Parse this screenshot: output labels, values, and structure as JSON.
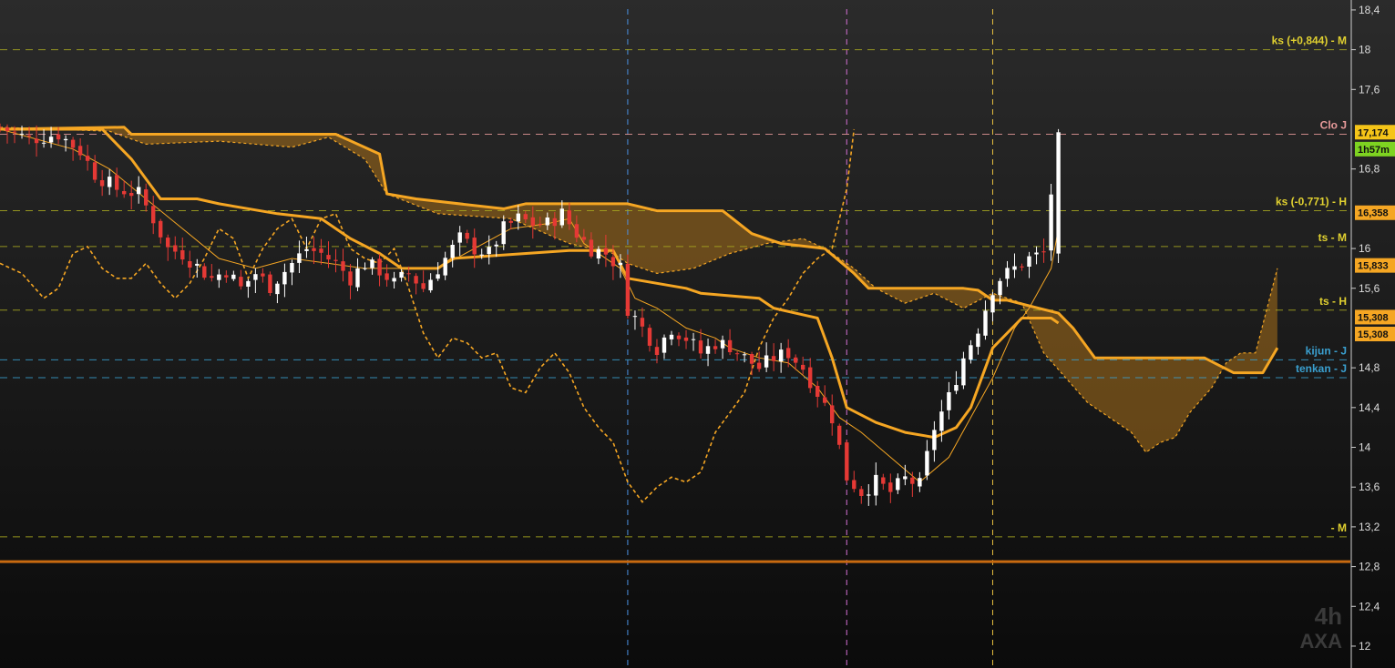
{
  "watermark": {
    "timeframe": "4h",
    "symbol": "AXA"
  },
  "colors": {
    "background_top": "#2a2a2a",
    "background_bottom": "#0c0c0c",
    "ichimoku": "#f5a623",
    "cloud_fill": "#a8701a",
    "bull": "#ffffff",
    "bear": "#e53935",
    "level_yellow": "#a8a820",
    "level_pink": "#e79a9a",
    "level_cyan": "#3aa0d0",
    "support_line": "#c86a10"
  },
  "chart_data": {
    "type": "candlestick",
    "y_axis": {
      "position": "right",
      "range": [
        11.78,
        18.5
      ],
      "ticks": [
        "18,4",
        "18",
        "17,6",
        "16,8",
        "16",
        "15,6",
        "14,8",
        "14,4",
        "14",
        "13,6",
        "13,2",
        "12,8",
        "12,4",
        "12"
      ],
      "tick_values": [
        18.4,
        18.0,
        17.6,
        16.8,
        16.0,
        15.6,
        14.8,
        14.4,
        14.0,
        13.6,
        13.2,
        12.8,
        12.4,
        12.0
      ]
    },
    "x_range": [
      0,
      185
    ],
    "last_candle_index": 145,
    "horizontal_levels": [
      {
        "label": "ks (+0,844) - M",
        "value": 18.0,
        "color": "#e0d030",
        "line": "#a8a820"
      },
      {
        "label": "Clo J",
        "value": 17.15,
        "color": "#e79a9a",
        "line": "#e79a9a"
      },
      {
        "label": "ks (-0,771) - H",
        "value": 16.38,
        "color": "#e0d030",
        "line": "#a8a820"
      },
      {
        "label": "ts - M",
        "value": 16.02,
        "color": "#e0d030",
        "line": "#a8a820"
      },
      {
        "label": "ts - H",
        "value": 15.38,
        "color": "#e0d030",
        "line": "#a8a820"
      },
      {
        "label": "kijun - J",
        "value": 14.88,
        "color": "#3aa0d0",
        "line": "#3aa0d0"
      },
      {
        "label": "tenkan - J",
        "value": 14.7,
        "color": "#3aa0d0",
        "line": "#3aa0d0"
      },
      {
        "label": "- M",
        "value": 13.1,
        "color": "#e0d030",
        "line": "#a8a820"
      }
    ],
    "support_line_value": 12.85,
    "price_tags": [
      {
        "text": "17,174",
        "value": 17.17,
        "bg": "#f5c518",
        "fg": "#111"
      },
      {
        "text": "1h57m",
        "value": 17.0,
        "bg": "#7ed321",
        "fg": "#111"
      },
      {
        "text": "16,358",
        "value": 16.36,
        "bg": "#f5a623",
        "fg": "#111"
      },
      {
        "text": "15,833",
        "value": 15.83,
        "bg": "#f5a623",
        "fg": "#111"
      },
      {
        "text": "15,308",
        "value": 15.31,
        "bg": "#f5a623",
        "fg": "#111"
      },
      {
        "text": "15,308",
        "value": 15.14,
        "bg": "#f5a623",
        "fg": "#111"
      }
    ],
    "vertical_markers": [
      {
        "index": 86,
        "color": "#4a90e2"
      },
      {
        "index": 116,
        "color": "#d36fd3"
      },
      {
        "index": 136,
        "color": "#e8c040"
      }
    ],
    "close_path": [
      [
        0,
        17.22
      ],
      [
        4,
        17.1
      ],
      [
        8,
        17.15
      ],
      [
        11,
        16.98
      ],
      [
        13,
        16.75
      ],
      [
        16,
        16.6
      ],
      [
        19,
        16.55
      ],
      [
        21,
        16.3
      ],
      [
        23,
        16.0
      ],
      [
        25,
        15.95
      ],
      [
        27,
        15.82
      ],
      [
        29,
        15.7
      ],
      [
        31,
        15.78
      ],
      [
        33,
        15.6
      ],
      [
        35,
        15.75
      ],
      [
        37,
        15.62
      ],
      [
        40,
        15.85
      ],
      [
        42,
        16.0
      ],
      [
        44,
        15.95
      ],
      [
        46,
        15.85
      ],
      [
        48,
        15.7
      ],
      [
        50,
        15.85
      ],
      [
        52,
        15.78
      ],
      [
        54,
        15.65
      ],
      [
        56,
        15.75
      ],
      [
        58,
        15.6
      ],
      [
        61,
        15.9
      ],
      [
        63,
        16.1
      ],
      [
        65,
        16.0
      ],
      [
        67,
        15.95
      ],
      [
        69,
        16.2
      ],
      [
        71,
        16.3
      ],
      [
        73,
        16.25
      ],
      [
        75,
        16.25
      ],
      [
        77,
        16.35
      ],
      [
        79,
        16.15
      ],
      [
        81,
        16.0
      ],
      [
        83,
        15.95
      ],
      [
        85,
        15.8
      ],
      [
        86,
        15.4
      ],
      [
        88,
        15.2
      ],
      [
        90,
        15.0
      ],
      [
        92,
        15.2
      ],
      [
        94,
        15.1
      ],
      [
        96,
        14.95
      ],
      [
        98,
        15.05
      ],
      [
        100,
        15.02
      ],
      [
        102,
        14.9
      ],
      [
        104,
        14.8
      ],
      [
        106,
        14.9
      ],
      [
        108,
        14.95
      ],
      [
        110,
        14.8
      ],
      [
        112,
        14.55
      ],
      [
        114,
        14.3
      ],
      [
        116,
        13.7
      ],
      [
        118,
        13.55
      ],
      [
        120,
        13.65
      ],
      [
        122,
        13.55
      ],
      [
        124,
        13.68
      ],
      [
        126,
        13.62
      ],
      [
        128,
        14.2
      ],
      [
        130,
        14.5
      ],
      [
        132,
        14.9
      ],
      [
        134,
        15.2
      ],
      [
        136,
        15.6
      ],
      [
        137,
        15.7
      ],
      [
        139,
        15.8
      ],
      [
        141,
        15.9
      ],
      [
        143,
        15.95
      ],
      [
        145,
        17.17
      ]
    ],
    "tenkan": [
      [
        0,
        17.2
      ],
      [
        10,
        17.0
      ],
      [
        15,
        16.8
      ],
      [
        20,
        16.5
      ],
      [
        25,
        16.2
      ],
      [
        30,
        15.9
      ],
      [
        35,
        15.8
      ],
      [
        40,
        15.9
      ],
      [
        45,
        15.85
      ],
      [
        50,
        15.8
      ],
      [
        55,
        15.8
      ],
      [
        60,
        15.8
      ],
      [
        65,
        16.0
      ],
      [
        70,
        16.2
      ],
      [
        75,
        16.25
      ],
      [
        78,
        16.3
      ],
      [
        80,
        16.05
      ],
      [
        85,
        15.8
      ],
      [
        87,
        15.5
      ],
      [
        90,
        15.4
      ],
      [
        94,
        15.2
      ],
      [
        98,
        15.1
      ],
      [
        100,
        15.0
      ],
      [
        104,
        14.9
      ],
      [
        108,
        14.85
      ],
      [
        112,
        14.6
      ],
      [
        115,
        14.3
      ],
      [
        118,
        14.15
      ],
      [
        122,
        13.9
      ],
      [
        126,
        13.65
      ],
      [
        130,
        13.9
      ],
      [
        133,
        14.3
      ],
      [
        136,
        14.7
      ],
      [
        139,
        15.2
      ],
      [
        141,
        15.4
      ],
      [
        144,
        15.8
      ],
      [
        145,
        16.2
      ]
    ],
    "kijun": [
      [
        0,
        17.2
      ],
      [
        14,
        17.2
      ],
      [
        18,
        16.9
      ],
      [
        22,
        16.5
      ],
      [
        27,
        16.5
      ],
      [
        30,
        16.45
      ],
      [
        38,
        16.35
      ],
      [
        44,
        16.3
      ],
      [
        48,
        16.1
      ],
      [
        52,
        15.95
      ],
      [
        55,
        15.8
      ],
      [
        60,
        15.8
      ],
      [
        62,
        15.9
      ],
      [
        78,
        15.98
      ],
      [
        80,
        15.98
      ],
      [
        82,
        15.98
      ],
      [
        84,
        15.98
      ],
      [
        86,
        15.7
      ],
      [
        94,
        15.6
      ],
      [
        96,
        15.55
      ],
      [
        104,
        15.5
      ],
      [
        106,
        15.4
      ],
      [
        112,
        15.3
      ],
      [
        114,
        14.9
      ],
      [
        116,
        14.4
      ],
      [
        120,
        14.25
      ],
      [
        124,
        14.15
      ],
      [
        128,
        14.1
      ],
      [
        131,
        14.2
      ],
      [
        133,
        14.4
      ],
      [
        136,
        15.0
      ],
      [
        140,
        15.3
      ],
      [
        144,
        15.3
      ],
      [
        145,
        15.25
      ]
    ],
    "senkou_b": [
      [
        0,
        17.2
      ],
      [
        17,
        17.22
      ],
      [
        18,
        17.15
      ],
      [
        46,
        17.15
      ],
      [
        52,
        16.95
      ],
      [
        53,
        16.55
      ],
      [
        57,
        16.5
      ],
      [
        69,
        16.4
      ],
      [
        72,
        16.45
      ],
      [
        86,
        16.45
      ],
      [
        90,
        16.38
      ],
      [
        99,
        16.38
      ],
      [
        103,
        16.15
      ],
      [
        107,
        16.05
      ],
      [
        113,
        16.0
      ],
      [
        117,
        15.75
      ],
      [
        119,
        15.6
      ],
      [
        132,
        15.6
      ],
      [
        134,
        15.58
      ],
      [
        136,
        15.48
      ],
      [
        138,
        15.48
      ],
      [
        145,
        15.35
      ],
      [
        147,
        15.2
      ],
      [
        150,
        14.9
      ],
      [
        165,
        14.9
      ],
      [
        169,
        14.75
      ],
      [
        173,
        14.75
      ],
      [
        175,
        15.0
      ]
    ],
    "senkou_a": [
      [
        0,
        17.22
      ],
      [
        15,
        17.18
      ],
      [
        20,
        17.05
      ],
      [
        30,
        17.08
      ],
      [
        40,
        17.02
      ],
      [
        45,
        17.12
      ],
      [
        50,
        16.9
      ],
      [
        53,
        16.55
      ],
      [
        60,
        16.35
      ],
      [
        70,
        16.3
      ],
      [
        78,
        16.05
      ],
      [
        84,
        15.95
      ],
      [
        86,
        15.85
      ],
      [
        90,
        15.75
      ],
      [
        95,
        15.8
      ],
      [
        100,
        15.95
      ],
      [
        105,
        16.05
      ],
      [
        110,
        16.1
      ],
      [
        113,
        16.0
      ],
      [
        117,
        15.8
      ],
      [
        120,
        15.6
      ],
      [
        124,
        15.45
      ],
      [
        128,
        15.55
      ],
      [
        132,
        15.4
      ],
      [
        136,
        15.55
      ],
      [
        140,
        15.45
      ],
      [
        143,
        14.95
      ],
      [
        146,
        14.7
      ],
      [
        149,
        14.45
      ],
      [
        152,
        14.3
      ],
      [
        155,
        14.15
      ],
      [
        157,
        13.95
      ],
      [
        159,
        14.05
      ],
      [
        161,
        14.1
      ],
      [
        163,
        14.35
      ],
      [
        166,
        14.6
      ],
      [
        168,
        14.85
      ],
      [
        170,
        14.95
      ],
      [
        172,
        14.95
      ],
      [
        175,
        15.8
      ]
    ],
    "chikou": [
      [
        0,
        15.85
      ],
      [
        3,
        15.75
      ],
      [
        6,
        15.5
      ],
      [
        8,
        15.6
      ],
      [
        10,
        15.95
      ],
      [
        12,
        16.02
      ],
      [
        14,
        15.8
      ],
      [
        16,
        15.7
      ],
      [
        18,
        15.7
      ],
      [
        20,
        15.85
      ],
      [
        22,
        15.65
      ],
      [
        24,
        15.5
      ],
      [
        26,
        15.65
      ],
      [
        28,
        15.9
      ],
      [
        30,
        16.2
      ],
      [
        32,
        16.1
      ],
      [
        34,
        15.7
      ],
      [
        36,
        16.0
      ],
      [
        38,
        16.2
      ],
      [
        40,
        16.3
      ],
      [
        42,
        16.0
      ],
      [
        44,
        16.3
      ],
      [
        46,
        16.35
      ],
      [
        48,
        16.0
      ],
      [
        50,
        15.9
      ],
      [
        52,
        15.85
      ],
      [
        54,
        16.0
      ],
      [
        56,
        15.6
      ],
      [
        58,
        15.15
      ],
      [
        60,
        14.9
      ],
      [
        62,
        15.1
      ],
      [
        64,
        15.05
      ],
      [
        66,
        14.9
      ],
      [
        68,
        14.95
      ],
      [
        70,
        14.6
      ],
      [
        72,
        14.55
      ],
      [
        74,
        14.8
      ],
      [
        76,
        14.95
      ],
      [
        78,
        14.75
      ],
      [
        80,
        14.4
      ],
      [
        82,
        14.2
      ],
      [
        84,
        14.05
      ],
      [
        86,
        13.65
      ],
      [
        88,
        13.45
      ],
      [
        90,
        13.6
      ],
      [
        92,
        13.7
      ],
      [
        94,
        13.65
      ],
      [
        96,
        13.75
      ],
      [
        98,
        14.15
      ],
      [
        100,
        14.35
      ],
      [
        102,
        14.55
      ],
      [
        104,
        15.0
      ],
      [
        106,
        15.3
      ],
      [
        108,
        15.5
      ],
      [
        110,
        15.75
      ],
      [
        112,
        15.9
      ],
      [
        114,
        16.0
      ],
      [
        116,
        16.6
      ],
      [
        117,
        17.2
      ]
    ]
  }
}
